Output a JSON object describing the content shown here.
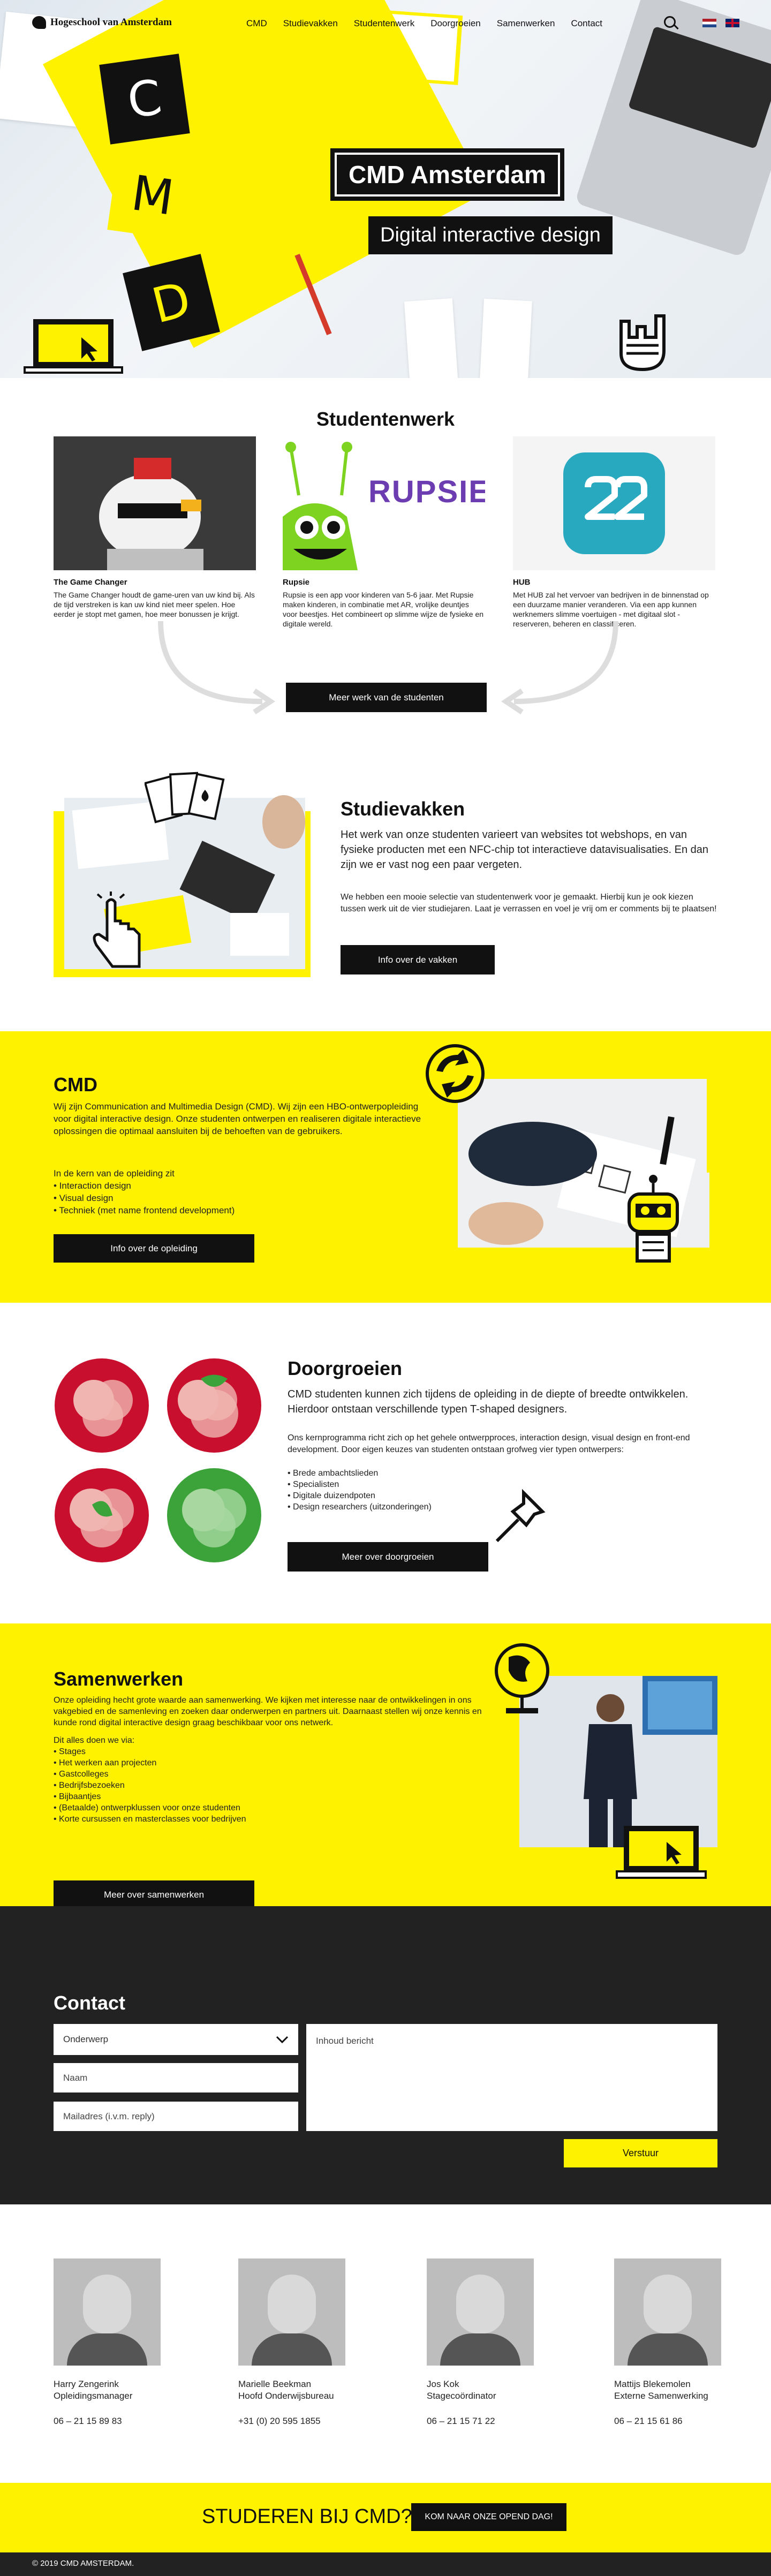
{
  "header": {
    "logo_text": "Hogeschool van Amsterdam",
    "nav": [
      "CMD",
      "Studievakken",
      "Studentenwerk",
      "Doorgroeien",
      "Samenwerken",
      "Contact"
    ]
  },
  "hero": {
    "letters": [
      "C",
      "M",
      "D"
    ],
    "title": "CMD Amsterdam",
    "subtitle": "Digital interactive design"
  },
  "studentenwerk": {
    "title": "Studentenwerk",
    "cards": [
      {
        "title": "The Game Changer",
        "text": "The Game Changer houdt de game-uren van uw kind bij. Als de tijd verstreken is kan uw kind niet meer spelen. Hoe eerder je stopt met gamen, hoe meer bonussen je krijgt."
      },
      {
        "title": "Rupsie",
        "text": "Rupsie is een app voor kinderen van 5-6 jaar. Met Rupsie maken kinderen, in combinatie met AR, vrolijke deuntjes voor beestjes. Het combineert op slimme wijze de fysieke en digitale wereld."
      },
      {
        "title": "HUB",
        "text": "Met HUB zal het vervoer van bedrijven in de binnenstad op een duurzame manier veranderen. Via een app kunnen werknemers slimme voertuigen - met digitaal slot - reserveren, beheren en classificeren."
      }
    ],
    "rupsie_logo": "RUPSIE",
    "button": "Meer werk van de studenten"
  },
  "studievakken": {
    "title": "Studievakken",
    "intro": "Het werk van onze studenten varieert van websites tot webshops, en van fysieke producten met een NFC-chip tot interactieve datavisualisaties. En dan zijn we er vast nog een paar vergeten.",
    "text": "We hebben een mooie selectie van studentenwerk voor je gemaakt. Hierbij kun je ook kiezen tussen werk uit de vier studiejaren. Laat je verrassen en voel je vrij om er comments bij te plaatsen!",
    "button": "Info over de vakken"
  },
  "cmd": {
    "title": "CMD",
    "intro": "Wij zijn Communication and Multimedia Design (CMD). Wij zijn een HBO-ontwerpopleiding voor digital interactive design. Onze studenten ontwerpen en realiseren digitale interactieve oplossingen die optimaal aansluiten bij de behoeften van de gebruikers.",
    "list_intro": "In de kern van de opleiding zit",
    "list": [
      "• Interaction design",
      "• Visual design",
      "• Techniek (met name frontend development)"
    ],
    "button": "Info over de opleiding"
  },
  "doorgroeien": {
    "title": "Doorgroeien",
    "intro": "CMD studenten kunnen zich tijdens de opleiding in de diepte of breedte ontwikkelen. Hierdoor ontstaan verschillende typen T-shaped designers.",
    "text": "Ons kernprogramma richt zich op het gehele ontwerpproces, interaction design, visual design en front-end development. Door eigen keuzes van studenten ontstaan grofweg vier typen ontwerpers:",
    "list": [
      "• Brede ambachtslieden",
      "• Specialisten",
      "• Digitale duizendpoten",
      "• Design researchers (uitzonderingen)"
    ],
    "button": "Meer over doorgroeien"
  },
  "samenwerken": {
    "title": "Samenwerken",
    "intro": "Onze opleiding hecht grote waarde aan samenwerking. We kijken met interesse naar de ontwikkelingen in ons vakgebied en de samenleving en zoeken daar onderwerpen en partners uit. Daarnaast stellen wij onze kennis en kunde rond digital interactive design graag beschikbaar voor ons netwerk.",
    "list_intro": "Dit alles doen we via:",
    "list": [
      "• Stages",
      "• Het werken aan projecten",
      "• Gastcolleges",
      "• Bedrijfsbezoeken",
      "• Bijbaantjes",
      "• (Betaalde) ontwerpklussen voor onze studenten",
      "• Korte cursussen en masterclasses voor bedrijven"
    ],
    "button": "Meer over samenwerken"
  },
  "contact": {
    "title": "Contact",
    "subject_value": "Onderwerp",
    "name_placeholder": "Naam",
    "email_placeholder": "Mailadres (i.v.m. reply)",
    "message_placeholder": "Inhoud bericht",
    "submit": "Verstuur"
  },
  "team": [
    {
      "name": "Harry Zengerink",
      "role": "Opleidingsmanager",
      "phone": "06 – 21 15 89 83"
    },
    {
      "name": "Marielle Beekman",
      "role": "Hoofd Onderwijsbureau",
      "phone": "+31 (0) 20 595 1855"
    },
    {
      "name": "Jos Kok",
      "role": "Stagecoördinator",
      "phone": "06 – 21 15 71 22"
    },
    {
      "name": "Mattijs Blekemolen",
      "role": "Externe Samenwerking",
      "phone": "06 – 21 15 61 86"
    }
  ],
  "cta": {
    "text": "STUDEREN BIJ CMD?",
    "button": "KOM NAAR ONZE OPEND DAG!"
  },
  "footer": {
    "text": "© 2019 CMD AMSTERDAM."
  },
  "colors": {
    "accent": "#fff200",
    "dark": "#222222",
    "black": "#111111"
  }
}
